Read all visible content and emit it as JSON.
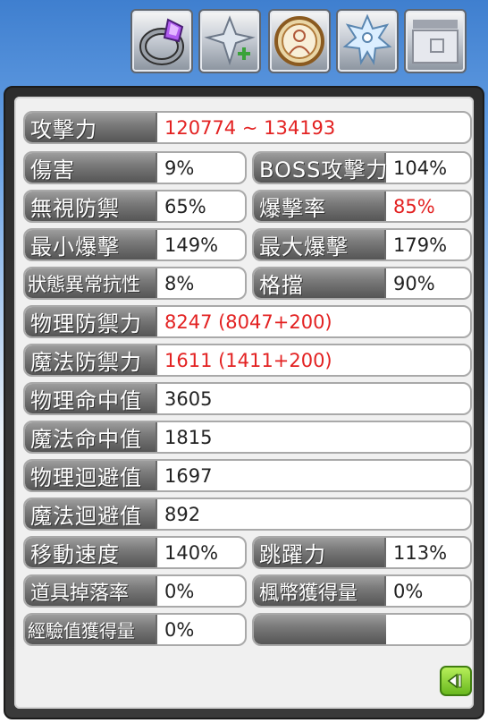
{
  "tabs": [
    {
      "icon": "ring-icon"
    },
    {
      "icon": "winged-emblem-icon"
    },
    {
      "icon": "medallion-icon"
    },
    {
      "icon": "snowflake-figure-icon"
    },
    {
      "icon": "card-slot-icon"
    }
  ],
  "stats": {
    "attack": {
      "label": "攻擊力",
      "value": "120774 ~ 134193"
    },
    "damage": {
      "label": "傷害",
      "value": "9%"
    },
    "boss_damage": {
      "label": "BOSS攻擊力",
      "value": "104%"
    },
    "ignore_defense": {
      "label": "無視防禦",
      "value": "65%"
    },
    "critical_rate": {
      "label": "爆擊率",
      "value": "85%"
    },
    "min_critical": {
      "label": "最小爆擊",
      "value": "149%"
    },
    "max_critical": {
      "label": "最大爆擊",
      "value": "179%"
    },
    "status_resist": {
      "label": "狀態異常抗性",
      "value": "8%"
    },
    "stance": {
      "label": "格擋",
      "value": "90%"
    },
    "physical_defense": {
      "label": "物理防禦力",
      "value": "8247 (8047+200)"
    },
    "magic_defense": {
      "label": "魔法防禦力",
      "value": "1611 (1411+200)"
    },
    "physical_accuracy": {
      "label": "物理命中值",
      "value": "3605"
    },
    "magic_accuracy": {
      "label": "魔法命中值",
      "value": "1815"
    },
    "physical_avoid": {
      "label": "物理迴避值",
      "value": "1697"
    },
    "magic_avoid": {
      "label": "魔法迴避值",
      "value": "892"
    },
    "speed": {
      "label": "移動速度",
      "value": "140%"
    },
    "jump": {
      "label": "跳躍力",
      "value": "113%"
    },
    "item_drop": {
      "label": "道具掉落率",
      "value": "0%"
    },
    "meso_gain": {
      "label": "楓幣獲得量",
      "value": "0%"
    },
    "exp_gain": {
      "label": "經驗值獲得量",
      "value": "0%"
    }
  },
  "colors": {
    "highlight_value": "#e32222",
    "back_button": "#69b81e"
  }
}
